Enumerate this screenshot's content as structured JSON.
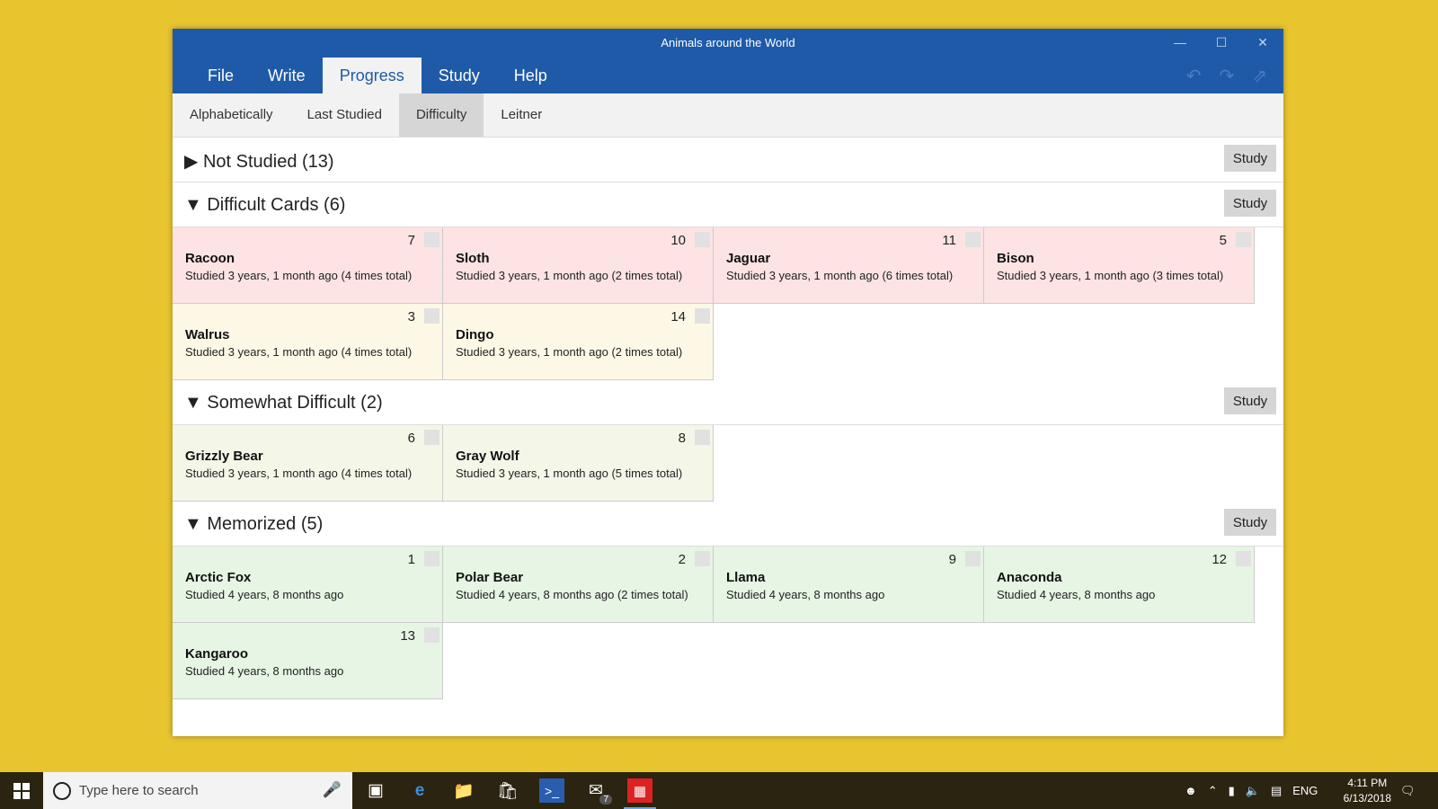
{
  "window": {
    "title": "Animals around the World",
    "menu": [
      "File",
      "Write",
      "Progress",
      "Study",
      "Help"
    ],
    "active_menu": "Progress"
  },
  "subtabs": [
    "Alphabetically",
    "Last Studied",
    "Difficulty",
    "Leitner"
  ],
  "active_subtab": "Difficulty",
  "study_label": "Study",
  "sections": [
    {
      "title": "Not Studied (13)",
      "expanded": false,
      "cards": []
    },
    {
      "title": "Difficult Cards (6)",
      "expanded": true,
      "cards": [
        {
          "num": "7",
          "name": "Racoon",
          "studied": "Studied 3 years, 1 month ago (4 times total)",
          "color": "red"
        },
        {
          "num": "10",
          "name": "Sloth",
          "studied": "Studied 3 years, 1 month ago (2 times total)",
          "color": "red"
        },
        {
          "num": "11",
          "name": "Jaguar",
          "studied": "Studied 3 years, 1 month ago (6 times total)",
          "color": "red"
        },
        {
          "num": "5",
          "name": "Bison",
          "studied": "Studied 3 years, 1 month ago (3 times total)",
          "color": "red"
        },
        {
          "num": "3",
          "name": "Walrus",
          "studied": "Studied 3 years, 1 month ago (4 times total)",
          "color": "yellow"
        },
        {
          "num": "14",
          "name": "Dingo",
          "studied": "Studied 3 years, 1 month ago (2 times total)",
          "color": "yellow"
        }
      ]
    },
    {
      "title": "Somewhat Difficult (2)",
      "expanded": true,
      "cards": [
        {
          "num": "6",
          "name": "Grizzly Bear",
          "studied": "Studied 3 years, 1 month ago (4 times total)",
          "color": "olive"
        },
        {
          "num": "8",
          "name": "Gray Wolf",
          "studied": "Studied 3 years, 1 month ago (5 times total)",
          "color": "olive"
        }
      ]
    },
    {
      "title": "Memorized (5)",
      "expanded": true,
      "cards": [
        {
          "num": "1",
          "name": "Arctic Fox",
          "studied": "Studied 4 years, 8 months ago",
          "color": "green"
        },
        {
          "num": "2",
          "name": "Polar Bear",
          "studied": "Studied 4 years, 8 months ago (2 times total)",
          "color": "green"
        },
        {
          "num": "9",
          "name": "Llama",
          "studied": "Studied 4 years, 8 months ago",
          "color": "green"
        },
        {
          "num": "12",
          "name": "Anaconda",
          "studied": "Studied 4 years, 8 months ago",
          "color": "green"
        },
        {
          "num": "13",
          "name": "Kangaroo",
          "studied": "Studied 4 years, 8 months ago",
          "color": "green"
        }
      ]
    }
  ],
  "colors": {
    "titlebar": "#1e5aa8",
    "desktop": "#e8c42f",
    "difficult": "#fde3e3",
    "difficult_light": "#fdf8e6",
    "somewhat": "#f4f7e8",
    "memorized": "#e6f5e4"
  },
  "taskbar": {
    "search_placeholder": "Type here to search",
    "mail_badge": "7",
    "lang": "ENG",
    "time": "4:11 PM",
    "date": "6/13/2018"
  }
}
